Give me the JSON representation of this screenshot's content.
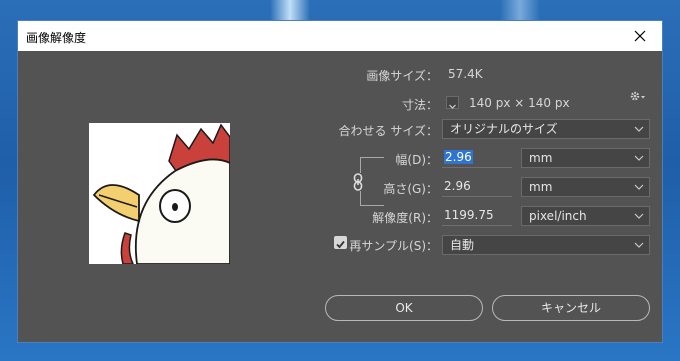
{
  "window": {
    "title": "画像解像度"
  },
  "image_size": {
    "label": "画像サイズ：",
    "value": "57.4K"
  },
  "dimensions": {
    "label": "寸法：",
    "value": "140 px × 140 px"
  },
  "fit_to": {
    "label": "合わせる サイズ：",
    "value": "オリジナルのサイズ"
  },
  "width": {
    "label": "幅(D)：",
    "value": "2.96",
    "unit": "mm"
  },
  "height": {
    "label": "高さ(G)：",
    "value": "2.96",
    "unit": "mm"
  },
  "resolution": {
    "label": "解像度(R)：",
    "value": "1199.75",
    "unit": "pixel/inch"
  },
  "resample": {
    "label": "再サンプル(S)：",
    "value": "自動",
    "checked": true
  },
  "buttons": {
    "ok": "OK",
    "cancel": "キャンセル"
  },
  "colors": {
    "dialog_bg": "#535353",
    "field_bg": "#454545",
    "selection": "#2f74d0"
  }
}
